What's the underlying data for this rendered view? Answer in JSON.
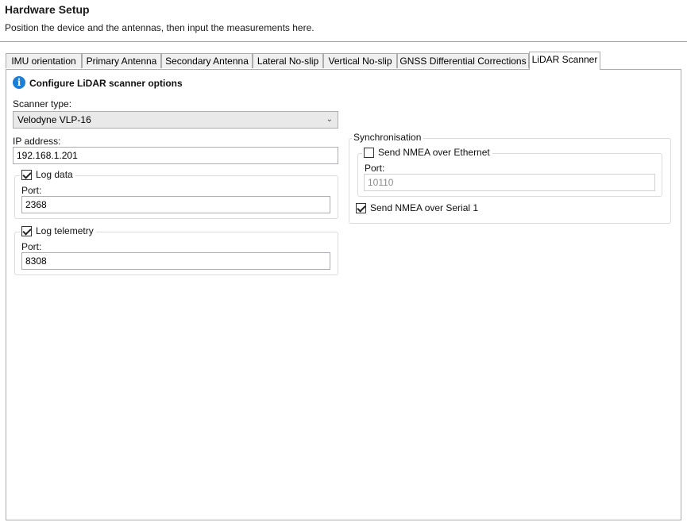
{
  "header": {
    "title": "Hardware Setup",
    "subtitle": "Position the device and the antennas, then input the measurements here."
  },
  "tabs": [
    {
      "label": "IMU orientation"
    },
    {
      "label": "Primary Antenna"
    },
    {
      "label": "Secondary Antenna"
    },
    {
      "label": "Lateral No-slip"
    },
    {
      "label": "Vertical No-slip"
    },
    {
      "label": "GNSS Differential Corrections"
    },
    {
      "label": "LiDAR Scanner",
      "active": true
    }
  ],
  "lidar": {
    "heading": "Configure LiDAR scanner options",
    "scanner_type_label": "Scanner type:",
    "scanner_type_value": "Velodyne VLP-16",
    "ip_label": "IP address:",
    "ip_value": "192.168.1.201",
    "log_data": {
      "label": "Log data",
      "checked": true,
      "port_label": "Port:",
      "port_value": "2368"
    },
    "log_telemetry": {
      "label": "Log telemetry",
      "checked": true,
      "port_label": "Port:",
      "port_value": "8308"
    },
    "sync": {
      "title": "Synchronisation",
      "nmea_ethernet": {
        "label": "Send NMEA over Ethernet",
        "checked": false,
        "port_label": "Port:",
        "port_value": "10110"
      },
      "nmea_serial": {
        "label": "Send NMEA over Serial 1",
        "checked": true
      }
    }
  },
  "colors": {
    "info_icon": "#1c7ed6"
  }
}
